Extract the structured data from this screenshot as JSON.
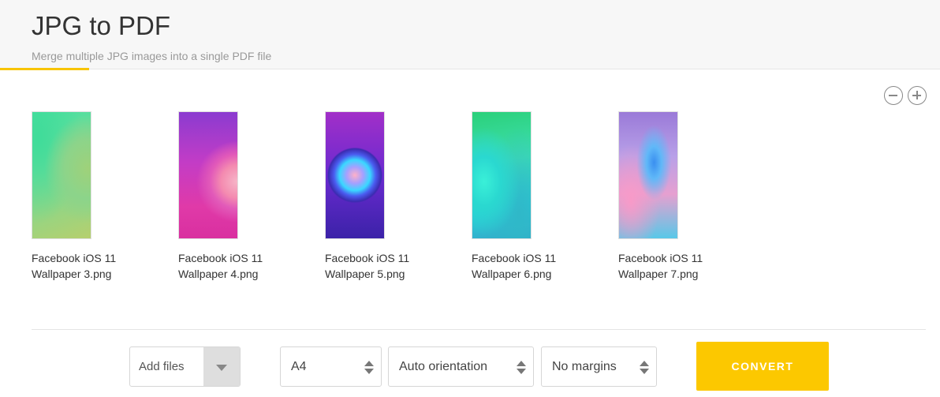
{
  "header": {
    "title": "JPG to PDF",
    "subtitle": "Merge multiple JPG images into a single PDF file",
    "accent_color": "#f8c400"
  },
  "zoom": {
    "out_icon": "zoom-out-icon",
    "in_icon": "zoom-in-icon"
  },
  "files": [
    {
      "line1": "Facebook iOS 11",
      "line2": "Wallpaper 3.png"
    },
    {
      "line1": "Facebook iOS 11",
      "line2": "Wallpaper 4.png"
    },
    {
      "line1": "Facebook iOS 11",
      "line2": "Wallpaper 5.png"
    },
    {
      "line1": "Facebook iOS 11",
      "line2": "Wallpaper 6.png"
    },
    {
      "line1": "Facebook iOS 11",
      "line2": "Wallpaper 7.png"
    }
  ],
  "toolbar": {
    "add_files_label": "Add files",
    "page_size": "A4",
    "orientation": "Auto orientation",
    "margins": "No margins",
    "convert_label": "CONVERT",
    "convert_color": "#fcc800"
  }
}
